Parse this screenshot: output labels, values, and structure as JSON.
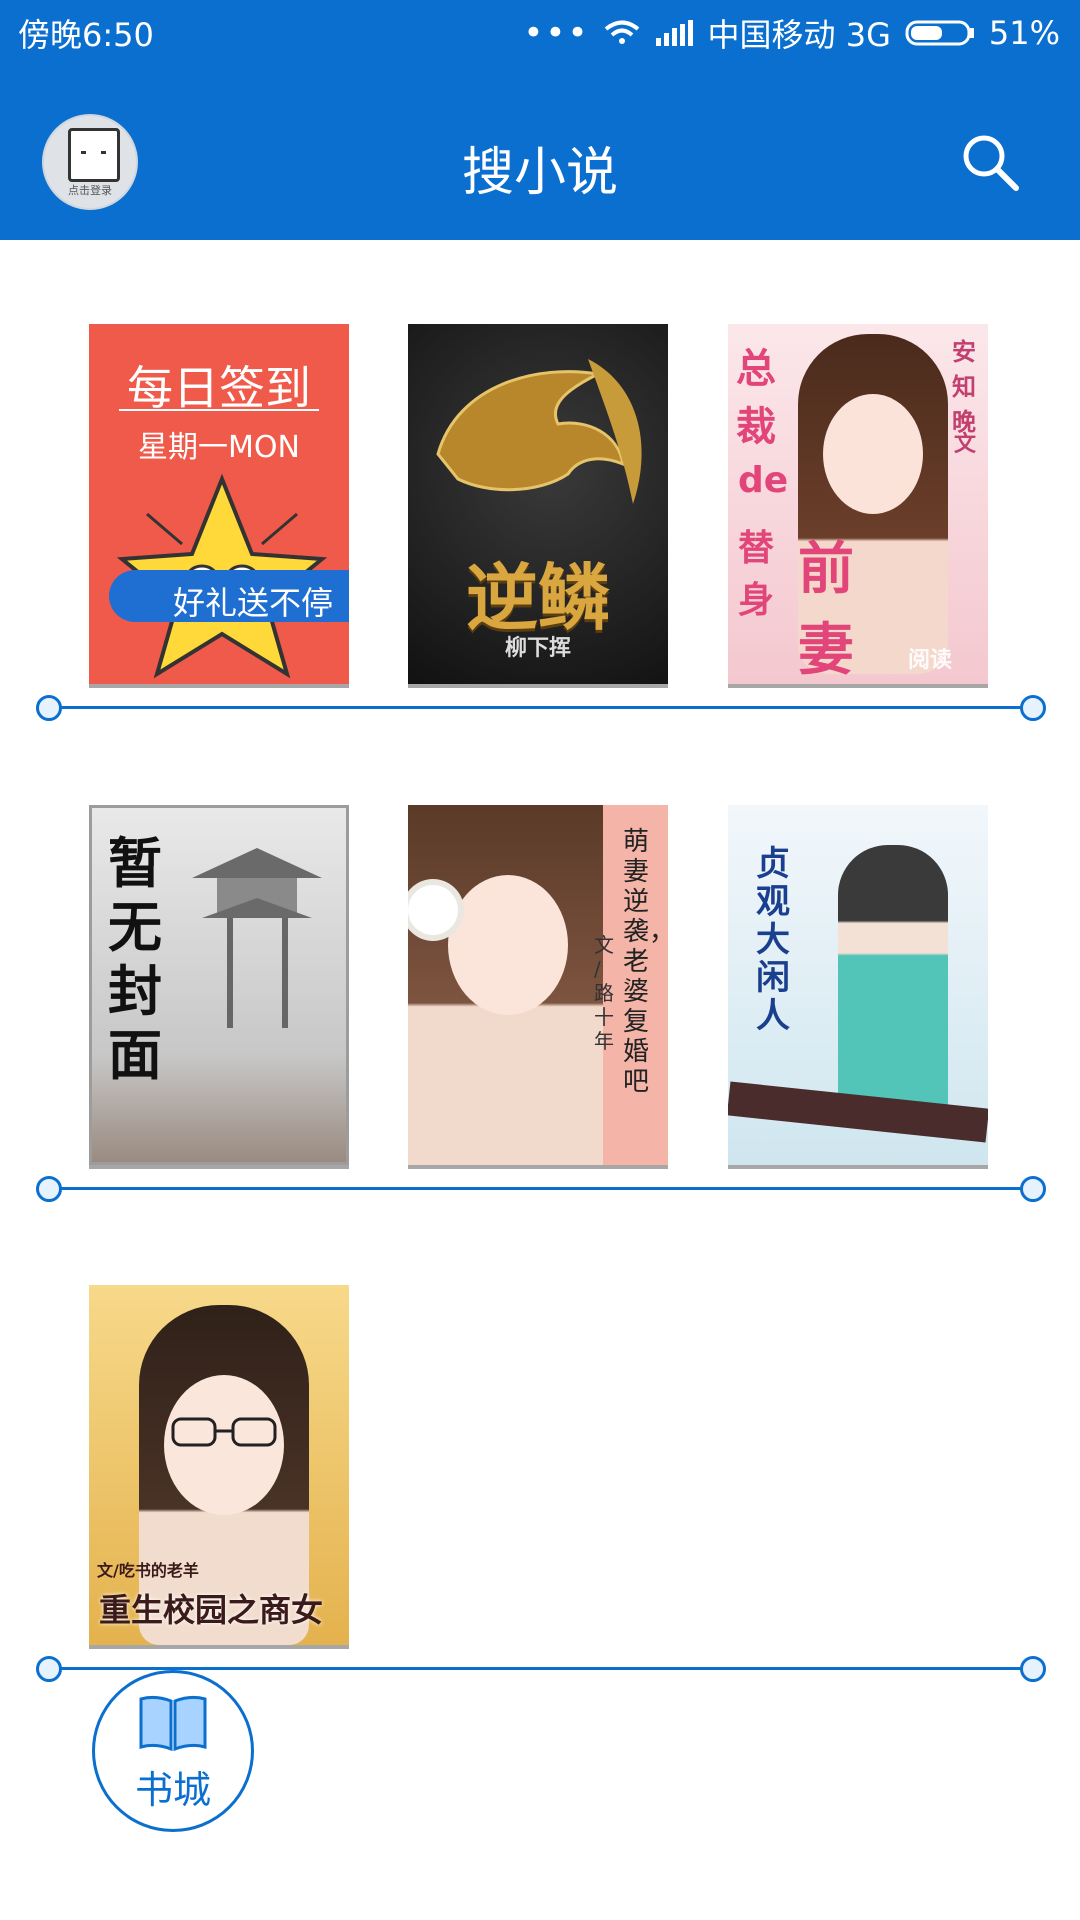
{
  "status_bar": {
    "time": "傍晚6:50",
    "carrier": "中国移动 3G",
    "battery": "51%",
    "signal_icon": "signal-icon",
    "wifi_icon": "wifi-icon"
  },
  "header": {
    "title": "搜小说",
    "avatar_label": "点击登录",
    "search_icon": "search-icon"
  },
  "books": [
    {
      "lines": [
        "每日签到",
        "星期一MON",
        "好礼送不停"
      ]
    },
    {
      "lines": [
        "逆鳞",
        "柳下挥"
      ]
    },
    {
      "lines": [
        "总裁",
        "de",
        "替身",
        "前妻",
        "安知晚",
        "文",
        "阅读"
      ]
    },
    {
      "lines": [
        "暂无封面"
      ]
    },
    {
      "lines": [
        "萌妻逆袭，老婆复婚吧",
        "文 / 路十年"
      ]
    },
    {
      "lines": [
        "贞观大闲人"
      ]
    },
    {
      "lines": [
        "文/吃书的老羊",
        "重生校园之商女"
      ]
    }
  ],
  "bottom": {
    "bookstore_label": "书城"
  },
  "colors": {
    "accent": "#0a6fcf",
    "signin_bg": "#f05a4a"
  }
}
